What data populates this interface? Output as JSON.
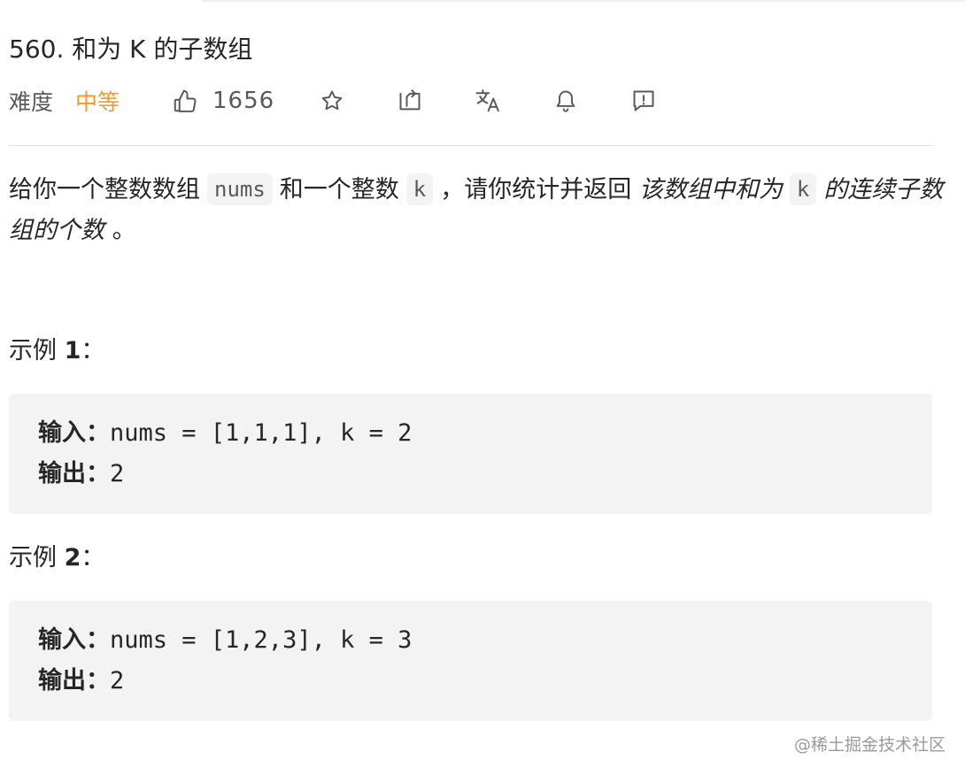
{
  "problem": {
    "title": "560. 和为 K 的子数组",
    "difficulty_label": "难度",
    "difficulty_value": "中等",
    "difficulty_color": "#ef9b2f",
    "likes": "1656"
  },
  "toolbar": {
    "icons": [
      "thumbs-up-icon",
      "star-icon",
      "share-icon",
      "translate-icon",
      "bell-icon",
      "feedback-icon"
    ]
  },
  "description": {
    "text_1": "给你一个整数数组",
    "code_1": "nums",
    "text_2": "和一个整数",
    "code_2": "k",
    "text_3": "，请你统计并返回",
    "em_1": "该数组中和为",
    "code_3": "k",
    "em_2": "的连续子数组的个数",
    "text_4": "。"
  },
  "examples": [
    {
      "heading_prefix": "示例",
      "heading_number": "1",
      "heading_suffix": "：",
      "input_label": "输入：",
      "input_value": "nums = [1,1,1], k = 2",
      "output_label": "输出：",
      "output_value": "2"
    },
    {
      "heading_prefix": "示例",
      "heading_number": "2",
      "heading_suffix": "：",
      "input_label": "输入：",
      "input_value": "nums = [1,2,3], k = 3",
      "output_label": "输出：",
      "output_value": "2"
    }
  ],
  "watermark": "@稀土掘金技术社区"
}
